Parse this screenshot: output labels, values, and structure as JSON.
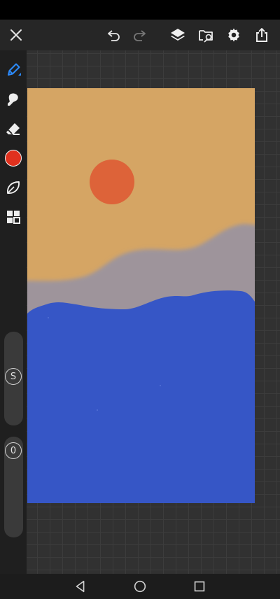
{
  "app": {
    "accent_color": "#2c8bff"
  },
  "toolbar": {
    "left_icons": [
      "close-icon"
    ],
    "right_icons": [
      "undo-icon",
      "redo-icon",
      "layers-icon",
      "folder-export-icon",
      "gear-icon",
      "share-icon"
    ]
  },
  "sidebar": {
    "tools": [
      "pen-icon",
      "smudge-icon",
      "eraser-icon",
      "color-swatch",
      "leaf-shape-icon",
      "grid-pattern-icon"
    ],
    "current_color": "#e0311e"
  },
  "sliders": {
    "size_label": "S",
    "opacity_label": "0"
  },
  "canvas": {
    "colors": {
      "sky": "#d5a564",
      "sun": "#dd6339",
      "mountains": "#9e949b",
      "sea": "#3656c6"
    }
  },
  "navbar": {
    "icons": [
      "back-icon",
      "home-icon",
      "recents-icon"
    ]
  }
}
